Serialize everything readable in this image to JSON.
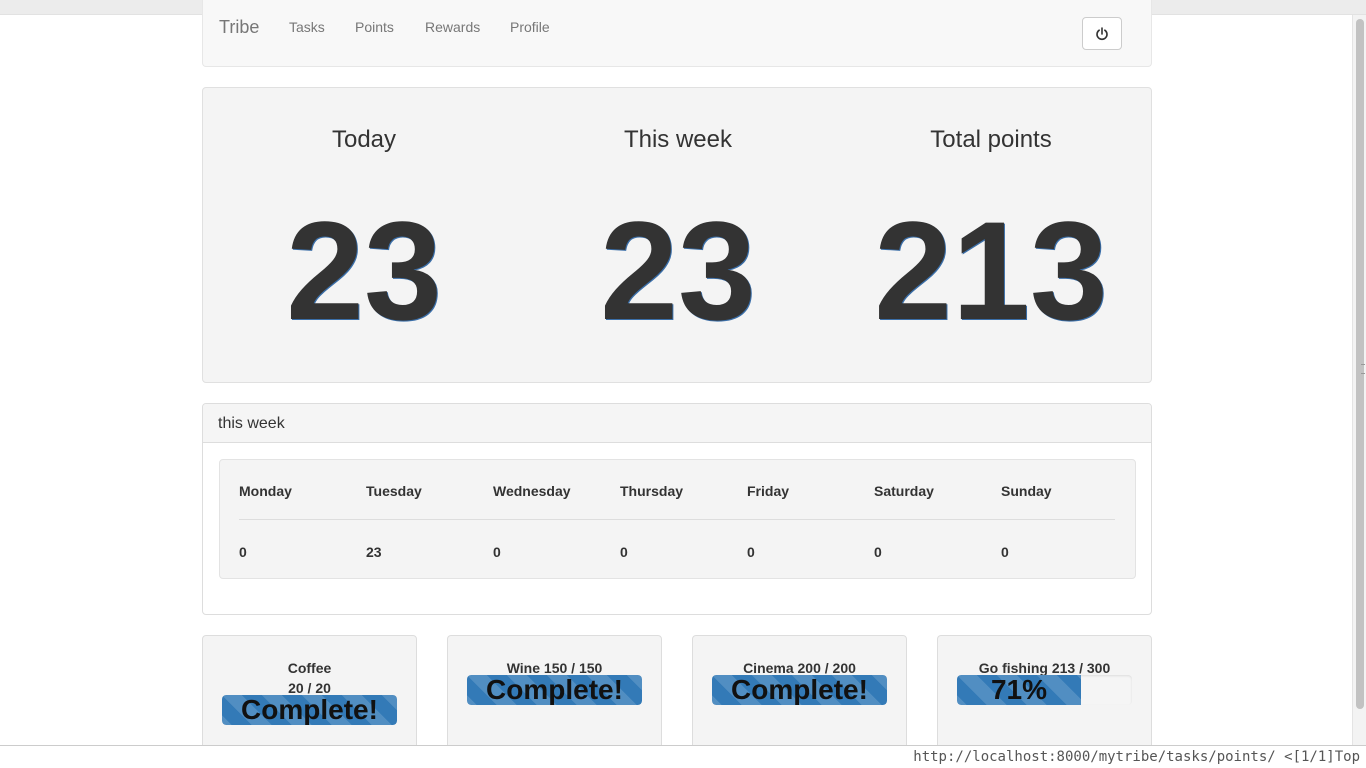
{
  "navbar": {
    "brand": "Tribe",
    "items": [
      {
        "label": "Tasks"
      },
      {
        "label": "Points"
      },
      {
        "label": "Rewards"
      },
      {
        "label": "Profile"
      }
    ],
    "logout_icon": "power-icon"
  },
  "stats": [
    {
      "label": "Today",
      "value": "23"
    },
    {
      "label": "This week",
      "value": "23"
    },
    {
      "label": "Total points",
      "value": "213"
    }
  ],
  "week_panel": {
    "title": "this week",
    "days": [
      {
        "day": "Monday",
        "points": "0"
      },
      {
        "day": "Tuesday",
        "points": "23"
      },
      {
        "day": "Wednesday",
        "points": "0"
      },
      {
        "day": "Thursday",
        "points": "0"
      },
      {
        "day": "Friday",
        "points": "0"
      },
      {
        "day": "Saturday",
        "points": "0"
      },
      {
        "day": "Sunday",
        "points": "0"
      }
    ]
  },
  "rewards": [
    {
      "title_line1": "Coffee",
      "title_line2": "20 / 20",
      "progress": 1.0,
      "bar_text": "Complete!"
    },
    {
      "title_line1": "Wine 150 / 150",
      "title_line2": "",
      "progress": 1.0,
      "bar_text": "Complete!"
    },
    {
      "title_line1": "Cinema 200 / 200",
      "title_line2": "",
      "progress": 1.0,
      "bar_text": "Complete!"
    },
    {
      "title_line1": "Go fishing 213 / 300",
      "title_line2": "",
      "progress": 0.71,
      "bar_text": "71%"
    }
  ],
  "colors": {
    "progress_bar": "#337ab7",
    "navbar_bg": "#f8f8f8",
    "jumbotron_bg": "#f4f4f4"
  },
  "statusline": {
    "url": "http://localhost:8000/mytribe/tasks/points/",
    "position": "<[1/1]Top"
  }
}
